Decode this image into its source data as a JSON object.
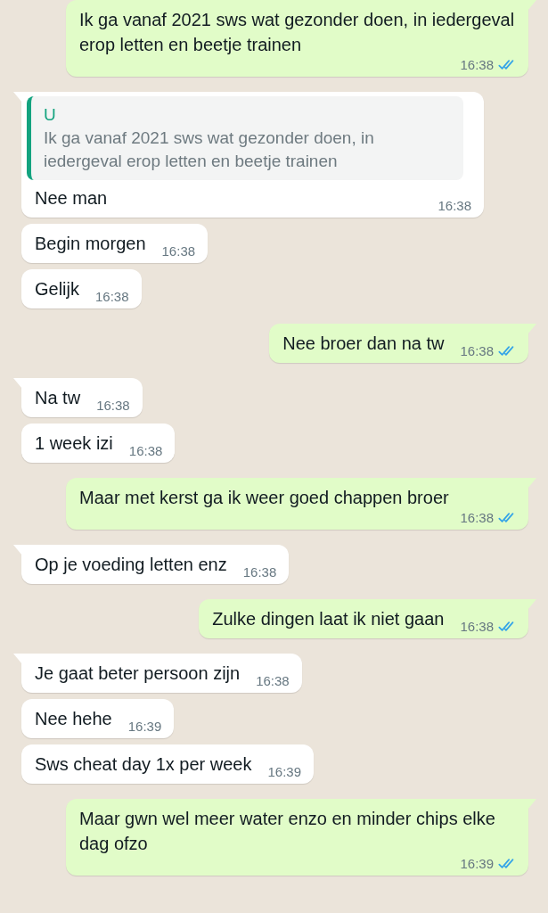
{
  "messages": [
    {
      "kind": "out",
      "text": "Ik ga vanaf 2021 sws wat gezonder doen, in iedergeval erop letten en beetje trainen",
      "time": "16:38",
      "read": true
    },
    {
      "kind": "in",
      "quote": {
        "author": "U",
        "text": "Ik ga vanaf 2021 sws wat gezonder doen, in iedergeval erop letten en beetje trainen"
      },
      "text": "Nee man",
      "time": "16:38"
    },
    {
      "kind": "in",
      "text": "Begin morgen",
      "time": "16:38"
    },
    {
      "kind": "in",
      "text": "Gelijk",
      "time": "16:38"
    },
    {
      "kind": "out",
      "text": "Nee broer dan na tw",
      "time": "16:38",
      "read": true
    },
    {
      "kind": "in",
      "text": "Na tw",
      "time": "16:38"
    },
    {
      "kind": "in",
      "text": "1 week izi",
      "time": "16:38"
    },
    {
      "kind": "out",
      "text": "Maar met kerst ga ik weer goed chappen broer",
      "time": "16:38",
      "read": true
    },
    {
      "kind": "in",
      "text": "Op je voeding letten enz",
      "time": "16:38"
    },
    {
      "kind": "out",
      "text": "Zulke dingen laat ik niet gaan",
      "time": "16:38",
      "read": true
    },
    {
      "kind": "in",
      "text": "Je gaat beter persoon zijn",
      "time": "16:38"
    },
    {
      "kind": "in",
      "text": "Nee hehe",
      "time": "16:39"
    },
    {
      "kind": "in",
      "text": "Sws cheat day 1x per week",
      "time": "16:39"
    },
    {
      "kind": "out",
      "text": "Maar gwn wel meer water enzo en minder chips elke dag ofzo",
      "time": "16:39",
      "read": true
    }
  ]
}
